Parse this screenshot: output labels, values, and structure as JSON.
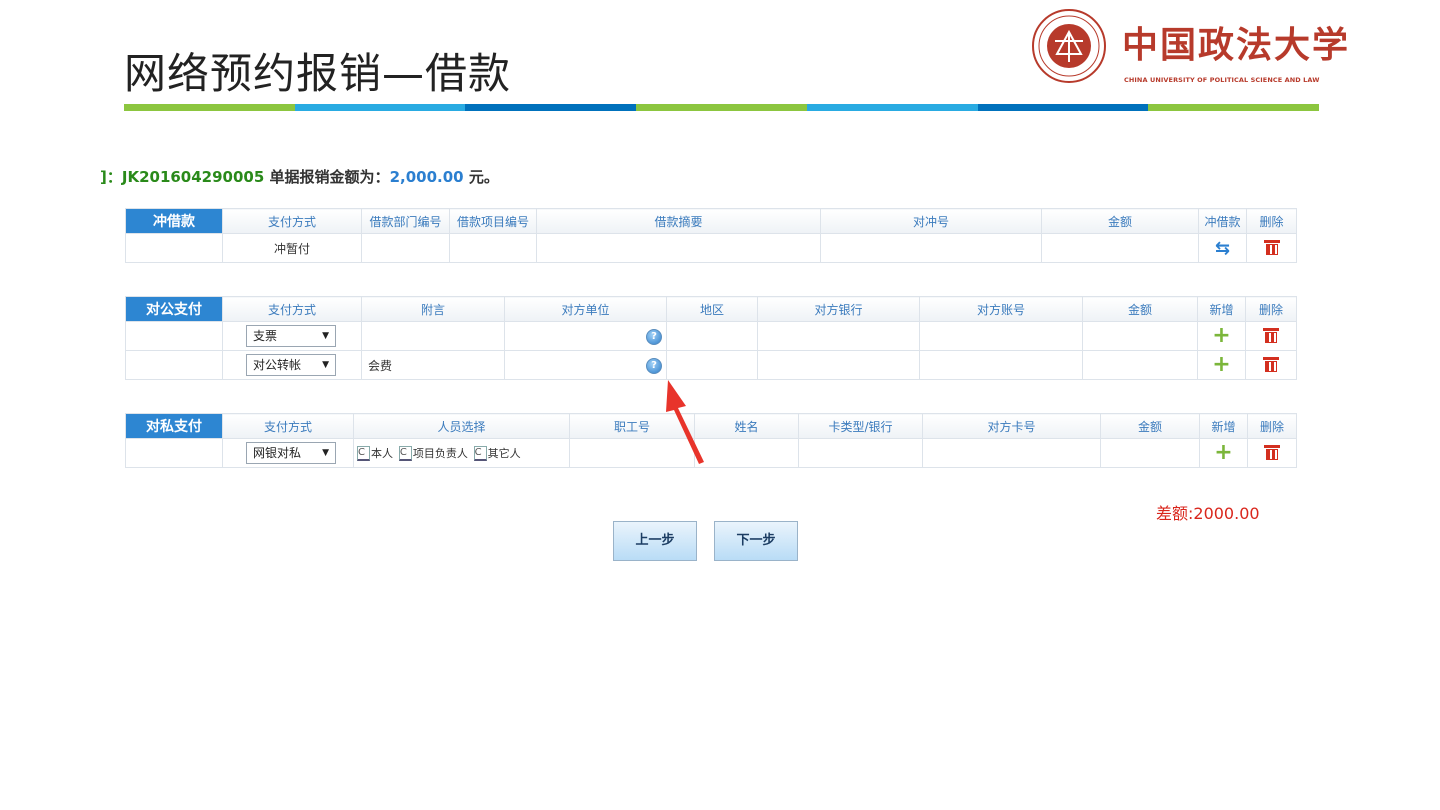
{
  "slide": {
    "title": "网络预约报销—借款",
    "bar_colors": [
      "#8cc63f",
      "#29abe2",
      "#0071bc",
      "#8cc63f",
      "#29abe2",
      "#0071bc",
      "#8cc63f"
    ]
  },
  "logo": {
    "name": "中国政法大学",
    "subtitle": "CHINA UNIVERSITY OF POLITICAL SCIENCE AND LAW"
  },
  "info": {
    "prefix": "]：",
    "code": "JK201604290005",
    "label": "单据报销金额为：",
    "amount": "2,000.00",
    "unit": "元。"
  },
  "loan_table": {
    "head": "冲借款",
    "columns": [
      "支付方式",
      "借款部门编号",
      "借款项目编号",
      "借款摘要",
      "对冲号",
      "金额",
      "冲借款",
      "删除"
    ],
    "rows": [
      {
        "method": "冲暂付"
      }
    ]
  },
  "public_table": {
    "head": "对公支付",
    "columns": [
      "支付方式",
      "附言",
      "对方单位",
      "地区",
      "对方银行",
      "对方账号",
      "金额",
      "新增",
      "删除"
    ],
    "rows": [
      {
        "method": "支票",
        "note": ""
      },
      {
        "method": "对公转帐",
        "note": "会费"
      }
    ]
  },
  "private_table": {
    "head": "对私支付",
    "columns": [
      "支付方式",
      "人员选择",
      "职工号",
      "姓名",
      "卡类型/银行",
      "对方卡号",
      "金额",
      "新增",
      "删除"
    ],
    "rows": [
      {
        "method": "网银对私",
        "options": [
          "本人",
          "项目负责人",
          "其它人"
        ]
      }
    ]
  },
  "difference": "差额:2000.00",
  "buttons": {
    "prev": "上一步",
    "next": "下一步"
  },
  "icons": {
    "dropdown": "chevron-down-icon",
    "help": "help-icon",
    "add": "plus-icon",
    "delete": "trash-icon",
    "offset": "swap-icon"
  }
}
